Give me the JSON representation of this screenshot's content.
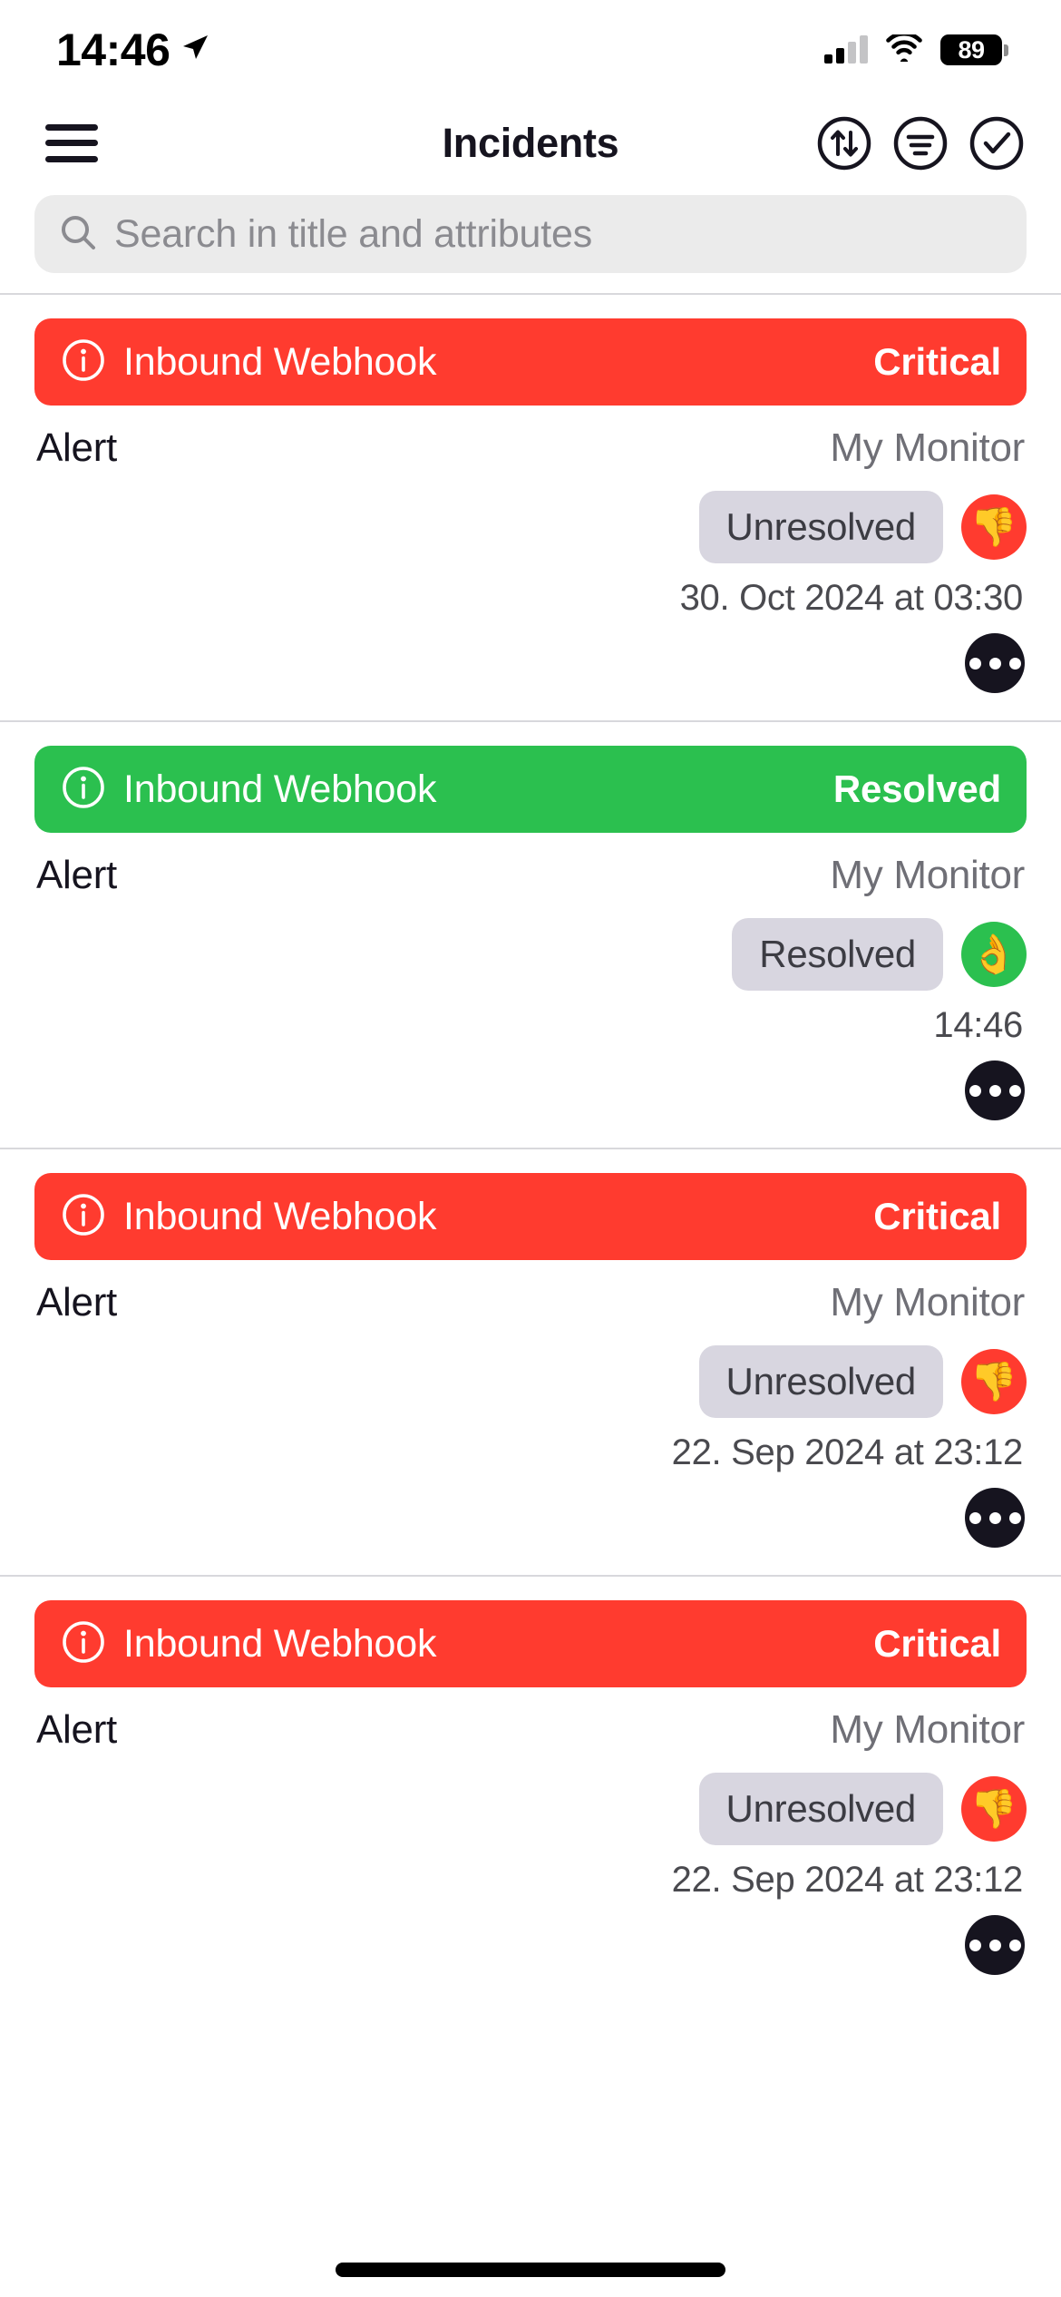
{
  "status_bar": {
    "time": "14:46",
    "location_icon": "location-arrow-icon",
    "cellular_icon": "cellular-signal-icon",
    "wifi_icon": "wifi-icon",
    "battery_percent": "89"
  },
  "nav_bar": {
    "menu_icon": "hamburger-menu-icon",
    "title": "Incidents",
    "actions": [
      {
        "name": "sort-button",
        "icon": "sort-arrows-icon"
      },
      {
        "name": "filter-button",
        "icon": "filter-lines-icon"
      },
      {
        "name": "acknowledge-button",
        "icon": "check-circle-icon"
      }
    ]
  },
  "search": {
    "icon": "search-icon",
    "placeholder": "Search in title and attributes",
    "value": ""
  },
  "colors": {
    "critical": "#FF3B2F",
    "resolved": "#2BC04F",
    "pill_bg": "#D8D6E0",
    "search_bg": "#EBEBEB",
    "ink": "#16141F"
  },
  "incidents": [
    {
      "banner_icon": "info-circle-icon",
      "title": "Inbound Webhook",
      "severity": "Critical",
      "severity_color": "#FF3B2F",
      "type": "Alert",
      "monitor": "My Monitor",
      "state": "Unresolved",
      "state_emoji": "👎",
      "state_emoji_name": "thumbs-down-emoji",
      "state_emoji_bg": "#FF3B2F",
      "timestamp": "30. Oct 2024 at 03:30",
      "more_icon": "more-ellipsis-icon"
    },
    {
      "banner_icon": "info-circle-icon",
      "title": "Inbound Webhook",
      "severity": "Resolved",
      "severity_color": "#2BC04F",
      "type": "Alert",
      "monitor": "My Monitor",
      "state": "Resolved",
      "state_emoji": "👌",
      "state_emoji_name": "ok-hand-emoji",
      "state_emoji_bg": "#2BC04F",
      "timestamp": "14:46",
      "more_icon": "more-ellipsis-icon"
    },
    {
      "banner_icon": "info-circle-icon",
      "title": "Inbound Webhook",
      "severity": "Critical",
      "severity_color": "#FF3B2F",
      "type": "Alert",
      "monitor": "My Monitor",
      "state": "Unresolved",
      "state_emoji": "👎",
      "state_emoji_name": "thumbs-down-emoji",
      "state_emoji_bg": "#FF3B2F",
      "timestamp": "22. Sep 2024 at 23:12",
      "more_icon": "more-ellipsis-icon"
    },
    {
      "banner_icon": "info-circle-icon",
      "title": "Inbound Webhook",
      "severity": "Critical",
      "severity_color": "#FF3B2F",
      "type": "Alert",
      "monitor": "My Monitor",
      "state": "Unresolved",
      "state_emoji": "👎",
      "state_emoji_name": "thumbs-down-emoji",
      "state_emoji_bg": "#FF3B2F",
      "timestamp": "22. Sep 2024 at 23:12",
      "more_icon": "more-ellipsis-icon"
    }
  ]
}
